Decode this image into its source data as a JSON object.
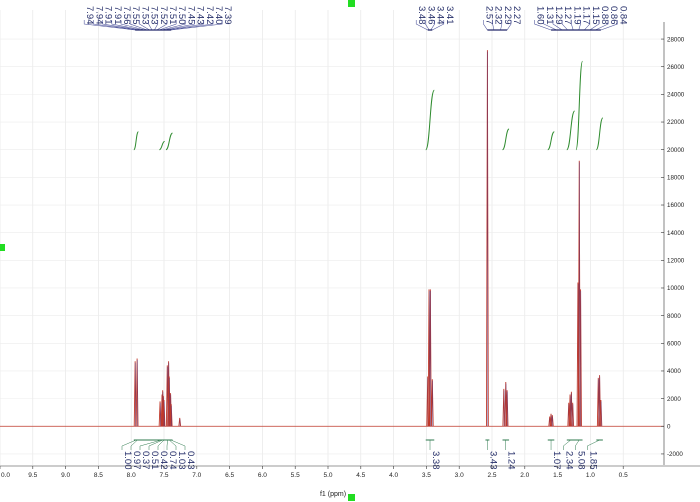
{
  "chart_data": {
    "type": "line",
    "xlabel": "f1 (ppm)",
    "ylabel": "",
    "x_reversed": true,
    "xlim": [
      10.0,
      0.0
    ],
    "ylim": [
      -2800,
      28800
    ],
    "x_ticks": [
      "0.0",
      "9.5",
      "9.0",
      "8.5",
      "8.0",
      "7.5",
      "7.0",
      "6.5",
      "6.0",
      "5.5",
      "5.0",
      "4.5",
      "4.0",
      "3.5",
      "3.0",
      "2.5",
      "2.0",
      "1.5",
      "1.0",
      "0.5"
    ],
    "y_ticks": [
      "28000",
      "26000",
      "24000",
      "22000",
      "20000",
      "18000",
      "16000",
      "14000",
      "12000",
      "10000",
      "8000",
      "6000",
      "4000",
      "2000",
      "0",
      "-2000"
    ],
    "y_tick_values": [
      28000,
      26000,
      24000,
      22000,
      20000,
      18000,
      16000,
      14000,
      12000,
      10000,
      8000,
      6000,
      4000,
      2000,
      0,
      -2000
    ],
    "grid": true,
    "series_color": "#c0392b",
    "integral_color": "#2e8b2e",
    "label_color": "#27306b",
    "peaks": [
      {
        "ppm": 7.94,
        "height": 4700
      },
      {
        "ppm": 7.91,
        "height": 4900
      },
      {
        "ppm": 7.56,
        "height": 1800
      },
      {
        "ppm": 7.53,
        "height": 2300
      },
      {
        "ppm": 7.52,
        "height": 2600
      },
      {
        "ppm": 7.51,
        "height": 2200
      },
      {
        "ppm": 7.5,
        "height": 1900
      },
      {
        "ppm": 7.45,
        "height": 4400
      },
      {
        "ppm": 7.43,
        "height": 4700
      },
      {
        "ppm": 7.42,
        "height": 3600
      },
      {
        "ppm": 7.4,
        "height": 2400
      },
      {
        "ppm": 7.39,
        "height": 1600
      },
      {
        "ppm": 7.26,
        "height": 600
      },
      {
        "ppm": 3.48,
        "height": 3600
      },
      {
        "ppm": 3.46,
        "height": 9900
      },
      {
        "ppm": 3.44,
        "height": 9900
      },
      {
        "ppm": 3.41,
        "height": 3400
      },
      {
        "ppm": 2.57,
        "height": 27200
      },
      {
        "ppm": 2.32,
        "height": 2700
      },
      {
        "ppm": 2.29,
        "height": 3200
      },
      {
        "ppm": 2.27,
        "height": 2600
      },
      {
        "ppm": 1.62,
        "height": 700
      },
      {
        "ppm": 1.6,
        "height": 900
      },
      {
        "ppm": 1.58,
        "height": 800
      },
      {
        "ppm": 1.33,
        "height": 1700
      },
      {
        "ppm": 1.31,
        "height": 2300
      },
      {
        "ppm": 1.29,
        "height": 2500
      },
      {
        "ppm": 1.27,
        "height": 1700
      },
      {
        "ppm": 1.19,
        "height": 10400
      },
      {
        "ppm": 1.17,
        "height": 19200
      },
      {
        "ppm": 1.15,
        "height": 9900
      },
      {
        "ppm": 0.88,
        "height": 3500
      },
      {
        "ppm": 0.86,
        "height": 3700
      },
      {
        "ppm": 0.84,
        "height": 1900
      }
    ],
    "peak_label_groups": [
      {
        "labels": [
          "7.94",
          "7.94",
          "7.91",
          "7.91",
          "7.56",
          "7.55",
          "7.53",
          "7.53",
          "7.52",
          "7.51",
          "7.50",
          "7.45",
          "7.43",
          "7.42",
          "7.40",
          "7.39"
        ],
        "from": 7.94,
        "to": 7.39
      },
      {
        "labels": [
          "3.48",
          "3.46",
          "3.44",
          "3.41"
        ],
        "from": 3.48,
        "to": 3.41
      },
      {
        "labels": [
          "2.57",
          "2.32",
          "2.29",
          "2.27"
        ],
        "from": 2.57,
        "to": 2.27
      },
      {
        "labels": [
          "1.60",
          "1.31",
          "1.29",
          "1.27",
          "1.19",
          "1.17",
          "1.15",
          "0.88",
          "0.86",
          "0.84"
        ],
        "from": 1.6,
        "to": 0.84
      }
    ],
    "integrals": [
      {
        "ppm": 7.925,
        "value": "1.00"
      },
      {
        "ppm": 7.905,
        "value": "0.97"
      },
      {
        "ppm": 7.54,
        "value": "0.37"
      },
      {
        "ppm": 7.52,
        "value": "0.51"
      },
      {
        "ppm": 7.5,
        "value": "0.42"
      },
      {
        "ppm": 7.445,
        "value": "0.74"
      },
      {
        "ppm": 7.42,
        "value": "1.03"
      },
      {
        "ppm": 7.395,
        "value": "0.43"
      },
      {
        "ppm": 3.445,
        "value": "3.38"
      },
      {
        "ppm": 2.57,
        "value": "3.43"
      },
      {
        "ppm": 2.295,
        "value": "1.24"
      },
      {
        "ppm": 1.6,
        "value": "1.07"
      },
      {
        "ppm": 1.3,
        "value": "2.34"
      },
      {
        "ppm": 1.17,
        "value": "5.08"
      },
      {
        "ppm": 0.86,
        "value": "1.85"
      }
    ],
    "integral_curves": [
      {
        "from": 7.96,
        "to": 7.89,
        "y0": 20000,
        "y1": 21300
      },
      {
        "from": 7.57,
        "to": 7.49,
        "y0": 20000,
        "y1": 20600
      },
      {
        "from": 7.47,
        "to": 7.37,
        "y0": 20000,
        "y1": 21200
      },
      {
        "from": 3.51,
        "to": 3.38,
        "y0": 20000,
        "y1": 24300
      },
      {
        "from": 2.34,
        "to": 2.24,
        "y0": 20000,
        "y1": 21500
      },
      {
        "from": 1.65,
        "to": 1.55,
        "y0": 20000,
        "y1": 21300
      },
      {
        "from": 1.36,
        "to": 1.24,
        "y0": 20000,
        "y1": 22800
      },
      {
        "from": 1.22,
        "to": 1.12,
        "y0": 20000,
        "y1": 26400
      },
      {
        "from": 0.91,
        "to": 0.81,
        "y0": 20000,
        "y1": 22300
      }
    ]
  }
}
